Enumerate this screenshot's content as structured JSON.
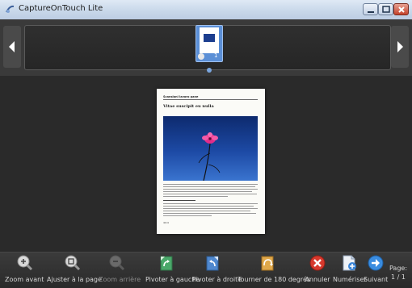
{
  "window": {
    "title": "CaptureOnTouch Lite"
  },
  "thumbnail": {
    "number": "1"
  },
  "page": {
    "header": "Scansioni lavoro pane",
    "title": "Vitae suscipit eu nulla",
    "footer": "4/14"
  },
  "toolbar": {
    "zoom_in": "Zoom avant",
    "fit_page": "Ajuster à la page",
    "zoom_out": "Zoom arrière",
    "rotate_left": "Pivoter à gauche",
    "rotate_right": "Pivoter à droite",
    "rotate_180": "Tourner de 180 degrés",
    "cancel": "Annuler",
    "scan": "Numériser",
    "next": "Suivant",
    "page_label": "Page:",
    "page_value": "1 / 1"
  }
}
